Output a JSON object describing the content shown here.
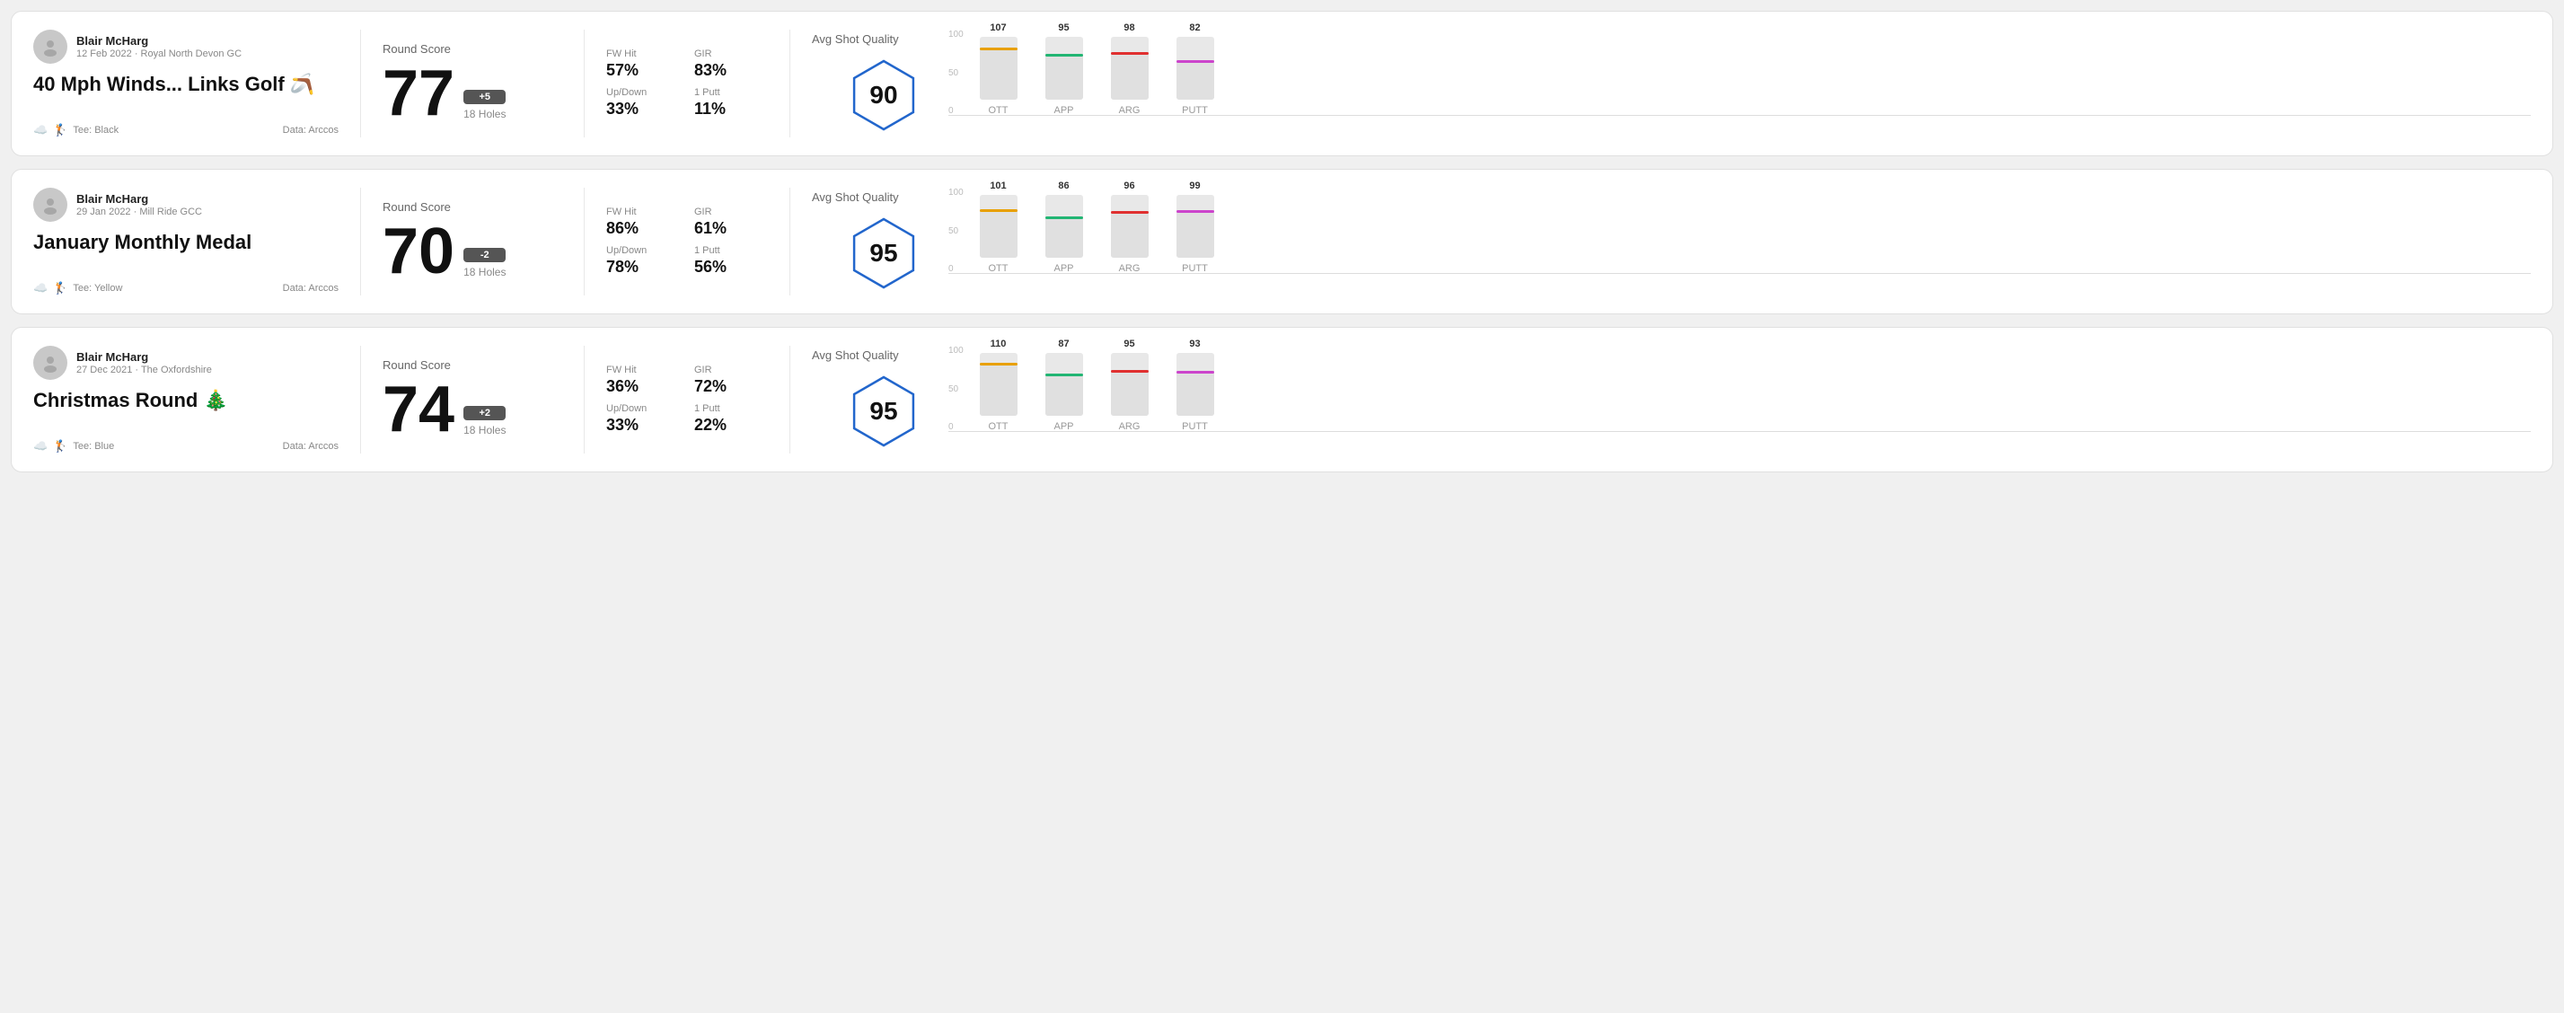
{
  "rounds": [
    {
      "id": "round1",
      "user": {
        "name": "Blair McHarg",
        "date": "12 Feb 2022",
        "course": "Royal North Devon GC"
      },
      "title": "40 Mph Winds... Links Golf 🪃",
      "tee": "Black",
      "data_source": "Data: Arccos",
      "score": {
        "label": "Round Score",
        "number": "77",
        "badge": "+5",
        "badge_positive": true,
        "holes": "18 Holes"
      },
      "stats": {
        "fw_hit_label": "FW Hit",
        "fw_hit_value": "57%",
        "gir_label": "GIR",
        "gir_value": "83%",
        "updown_label": "Up/Down",
        "updown_value": "33%",
        "oneputt_label": "1 Putt",
        "oneputt_value": "11%"
      },
      "quality": {
        "label": "Avg Shot Quality",
        "score": "90"
      },
      "chart": {
        "bars": [
          {
            "label": "OTT",
            "value": 107,
            "color": "#e8a000",
            "max": 130
          },
          {
            "label": "APP",
            "value": 95,
            "color": "#22b573",
            "max": 130
          },
          {
            "label": "ARG",
            "value": 98,
            "color": "#e03030",
            "max": 130
          },
          {
            "label": "PUTT",
            "value": 82,
            "color": "#cc44cc",
            "max": 130
          }
        ]
      }
    },
    {
      "id": "round2",
      "user": {
        "name": "Blair McHarg",
        "date": "29 Jan 2022",
        "course": "Mill Ride GCC"
      },
      "title": "January Monthly Medal",
      "tee": "Yellow",
      "data_source": "Data: Arccos",
      "score": {
        "label": "Round Score",
        "number": "70",
        "badge": "-2",
        "badge_positive": false,
        "holes": "18 Holes"
      },
      "stats": {
        "fw_hit_label": "FW Hit",
        "fw_hit_value": "86%",
        "gir_label": "GIR",
        "gir_value": "61%",
        "updown_label": "Up/Down",
        "updown_value": "78%",
        "oneputt_label": "1 Putt",
        "oneputt_value": "56%"
      },
      "quality": {
        "label": "Avg Shot Quality",
        "score": "95"
      },
      "chart": {
        "bars": [
          {
            "label": "OTT",
            "value": 101,
            "color": "#e8a000",
            "max": 130
          },
          {
            "label": "APP",
            "value": 86,
            "color": "#22b573",
            "max": 130
          },
          {
            "label": "ARG",
            "value": 96,
            "color": "#e03030",
            "max": 130
          },
          {
            "label": "PUTT",
            "value": 99,
            "color": "#cc44cc",
            "max": 130
          }
        ]
      }
    },
    {
      "id": "round3",
      "user": {
        "name": "Blair McHarg",
        "date": "27 Dec 2021",
        "course": "The Oxfordshire"
      },
      "title": "Christmas Round 🎄",
      "tee": "Blue",
      "data_source": "Data: Arccos",
      "score": {
        "label": "Round Score",
        "number": "74",
        "badge": "+2",
        "badge_positive": true,
        "holes": "18 Holes"
      },
      "stats": {
        "fw_hit_label": "FW Hit",
        "fw_hit_value": "36%",
        "gir_label": "GIR",
        "gir_value": "72%",
        "updown_label": "Up/Down",
        "updown_value": "33%",
        "oneputt_label": "1 Putt",
        "oneputt_value": "22%"
      },
      "quality": {
        "label": "Avg Shot Quality",
        "score": "95"
      },
      "chart": {
        "bars": [
          {
            "label": "OTT",
            "value": 110,
            "color": "#e8a000",
            "max": 130
          },
          {
            "label": "APP",
            "value": 87,
            "color": "#22b573",
            "max": 130
          },
          {
            "label": "ARG",
            "value": 95,
            "color": "#e03030",
            "max": 130
          },
          {
            "label": "PUTT",
            "value": 93,
            "color": "#cc44cc",
            "max": 130
          }
        ]
      }
    }
  ],
  "chart_y_labels": [
    "100",
    "50",
    "0"
  ]
}
